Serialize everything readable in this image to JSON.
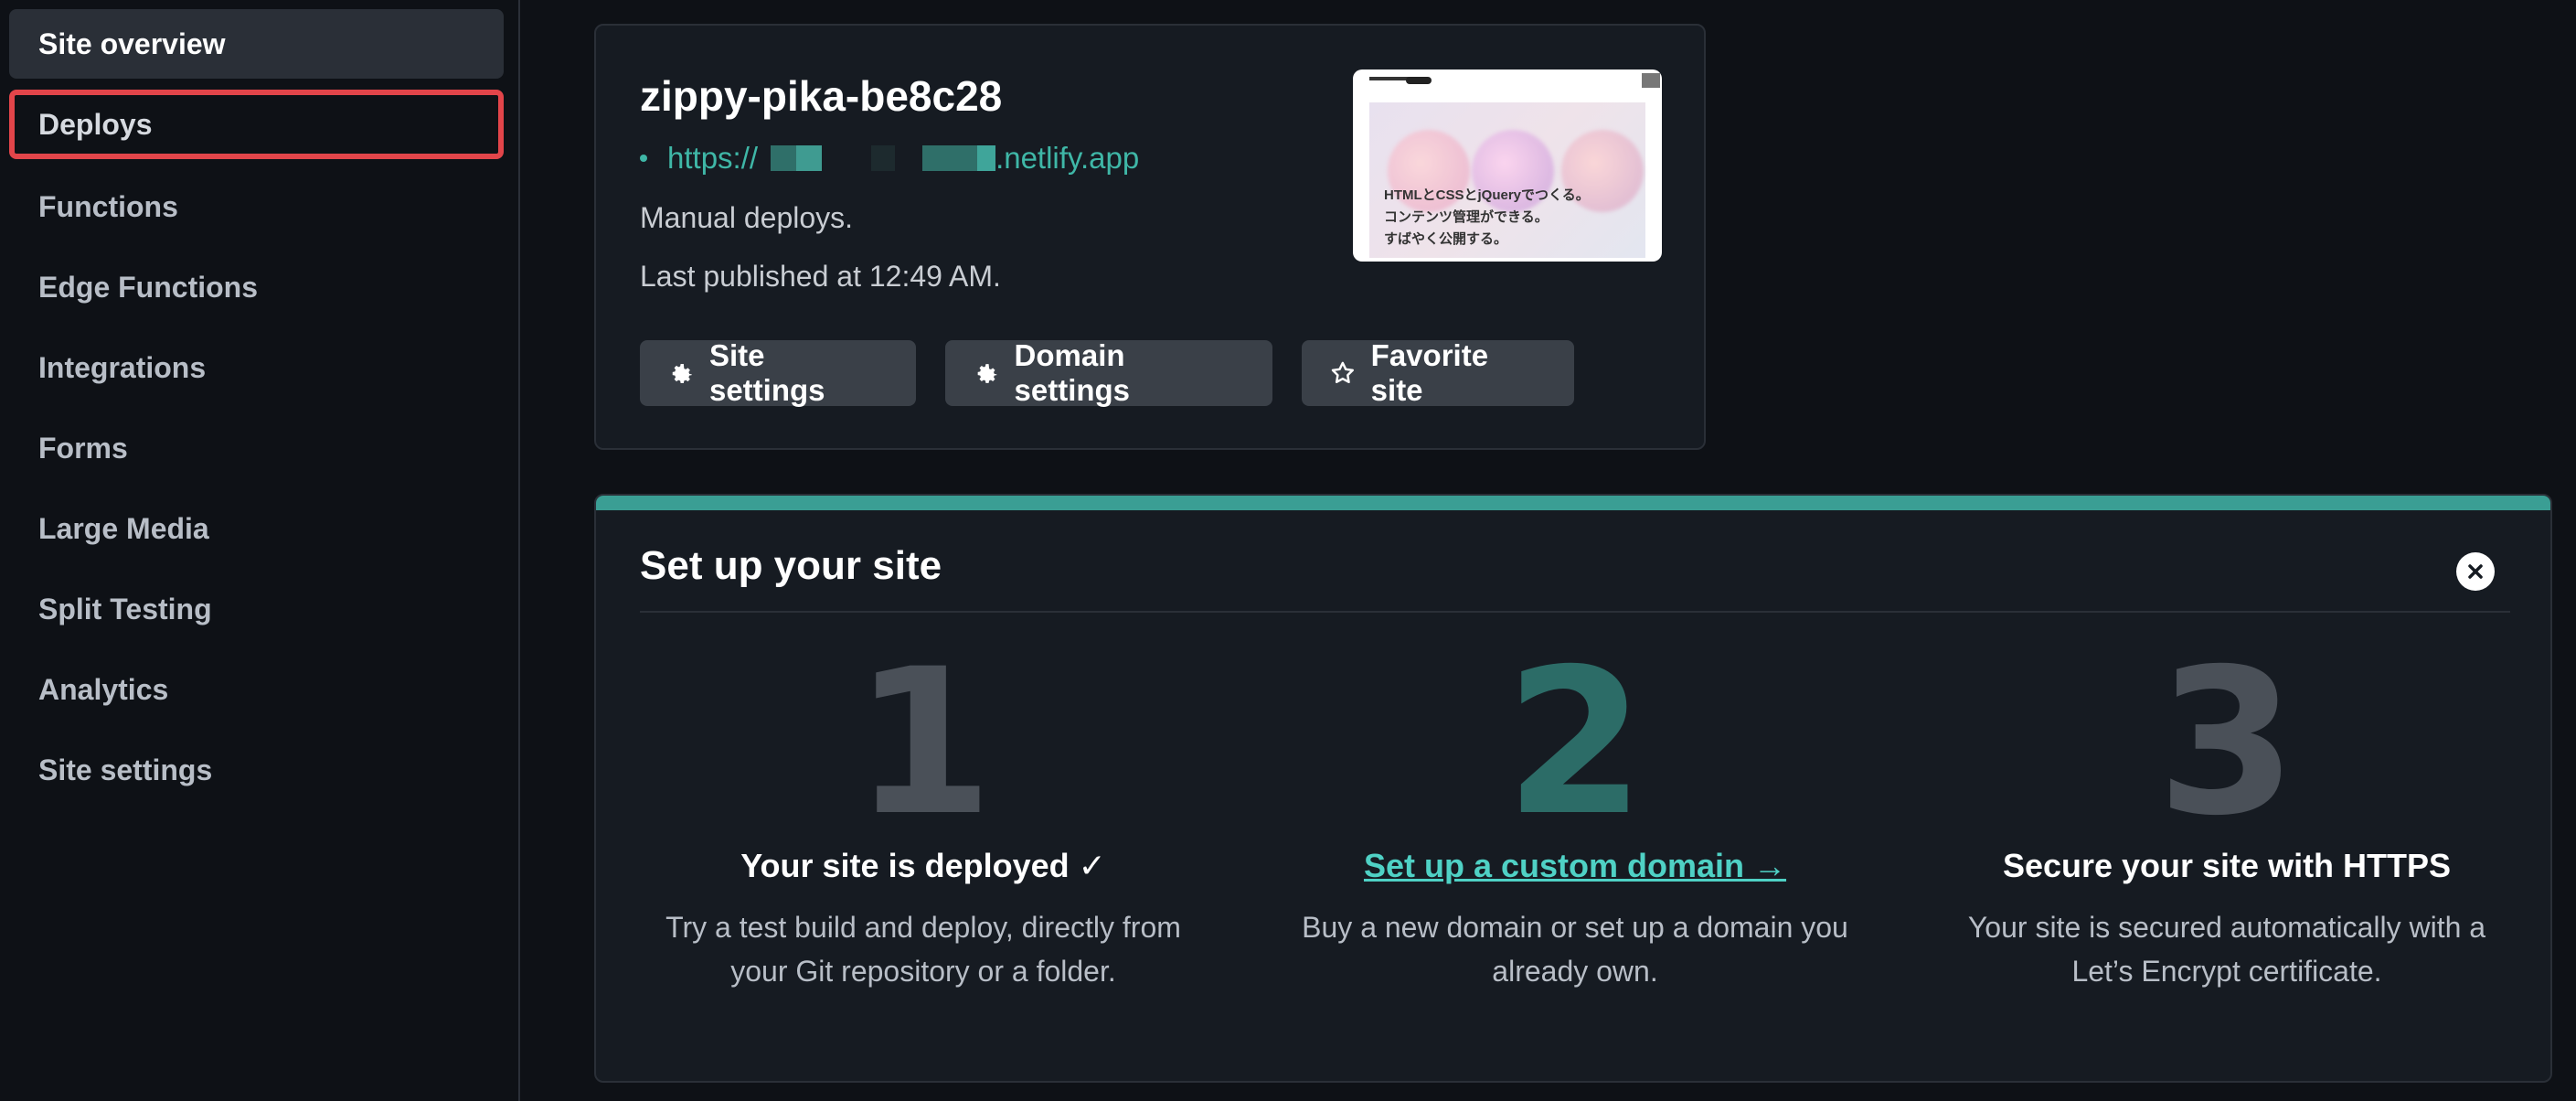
{
  "sidebar": {
    "items": [
      {
        "label": "Site overview"
      },
      {
        "label": "Deploys"
      },
      {
        "label": "Functions"
      },
      {
        "label": "Edge Functions"
      },
      {
        "label": "Integrations"
      },
      {
        "label": "Forms"
      },
      {
        "label": "Large Media"
      },
      {
        "label": "Split Testing"
      },
      {
        "label": "Analytics"
      },
      {
        "label": "Site settings"
      }
    ]
  },
  "site": {
    "name": "zippy-pika-be8c28",
    "url_prefix": "https://",
    "url_suffix": ".netlify.app",
    "deploy_mode": "Manual deploys.",
    "last_published": "Last published at 12:49 AM.",
    "buttons": {
      "site_settings": "Site settings",
      "domain_settings": "Domain settings",
      "favorite": "Favorite site"
    },
    "preview": {
      "line1": "HTMLとCSSとjQueryでつくる。",
      "line2": "コンテンツ管理ができる。",
      "line3": "すばやく公開する。"
    }
  },
  "setup": {
    "title": "Set up your site",
    "steps": [
      {
        "number": "1",
        "title": "Your site is deployed ✓",
        "desc_line1": "Try a test build and deploy, directly from",
        "desc_line2": "your Git repository or a folder."
      },
      {
        "number": "2",
        "title": "Set up a custom domain →",
        "desc_line1": "Buy a new domain or set up a domain you",
        "desc_line2": "already own."
      },
      {
        "number": "3",
        "title": "Secure your site with HTTPS",
        "desc_line1": "Your site is secured automatically with a",
        "desc_line2": "Let’s Encrypt certificate."
      }
    ]
  },
  "colors": {
    "accent": "#3fb7a7",
    "highlight": "#e2454a",
    "background": "#0e1116"
  }
}
